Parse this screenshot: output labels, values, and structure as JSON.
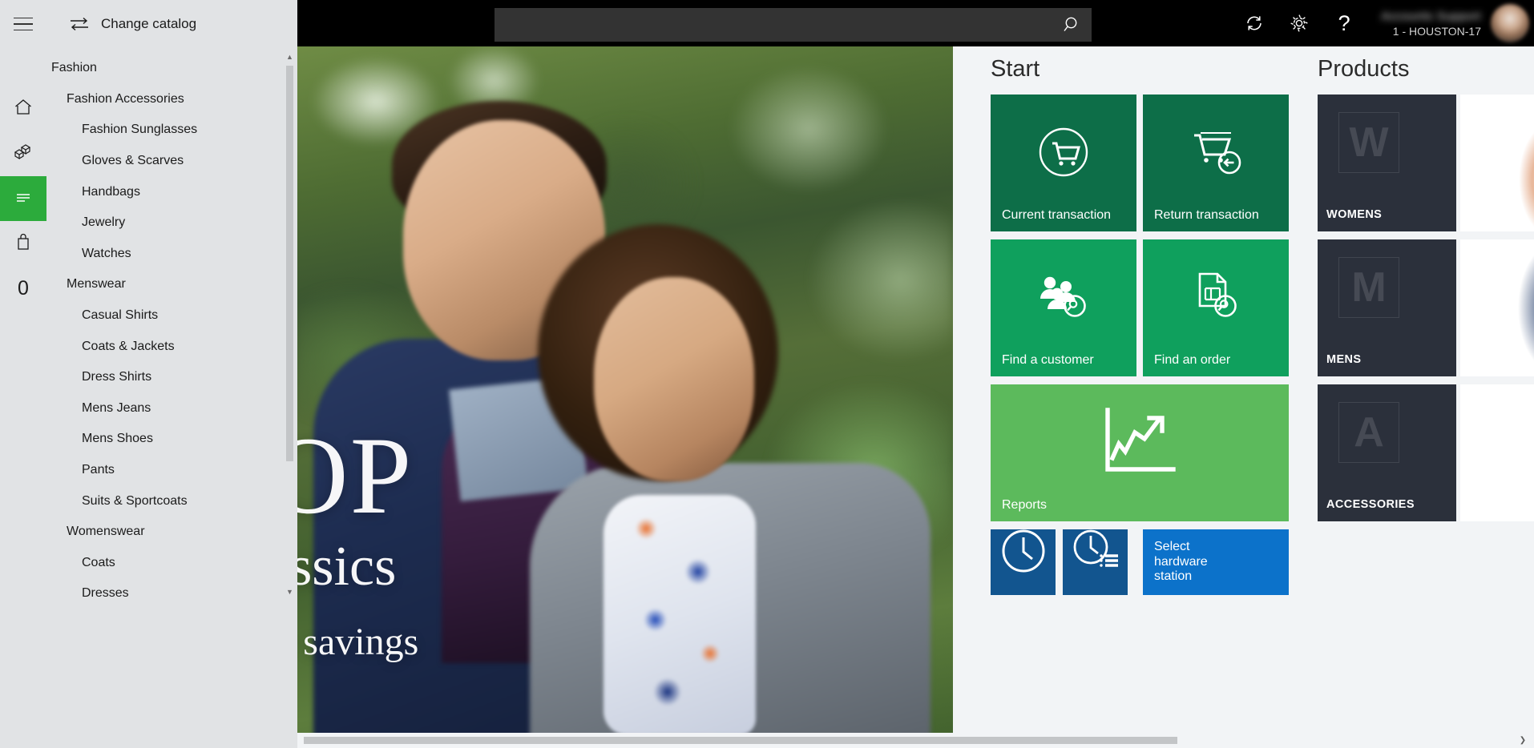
{
  "sidebar": {
    "hamburger_label": "menu-toggle",
    "change_catalog_label": "Change catalog",
    "rail": [
      {
        "name": "home",
        "glyph": "home-icon"
      },
      {
        "name": "products",
        "glyph": "products-icon"
      },
      {
        "name": "categories",
        "glyph": "categories-icon",
        "active": true
      },
      {
        "name": "bag",
        "glyph": "shopping-bag-icon"
      },
      {
        "name": "count",
        "glyph": "0"
      }
    ],
    "categories": [
      {
        "label": "Fashion",
        "level": 0
      },
      {
        "label": "Fashion Accessories",
        "level": 1
      },
      {
        "label": "Fashion Sunglasses",
        "level": 2
      },
      {
        "label": "Gloves & Scarves",
        "level": 2
      },
      {
        "label": "Handbags",
        "level": 2
      },
      {
        "label": "Jewelry",
        "level": 2
      },
      {
        "label": "Watches",
        "level": 2
      },
      {
        "label": "Menswear",
        "level": 1
      },
      {
        "label": "Casual Shirts",
        "level": 2
      },
      {
        "label": "Coats & Jackets",
        "level": 2
      },
      {
        "label": "Dress Shirts",
        "level": 2
      },
      {
        "label": "Mens Jeans",
        "level": 2
      },
      {
        "label": "Mens Shoes",
        "level": 2
      },
      {
        "label": "Pants",
        "level": 2
      },
      {
        "label": "Suits & Sportcoats",
        "level": 2
      },
      {
        "label": "Womenswear",
        "level": 1
      },
      {
        "label": "Coats",
        "level": 2
      },
      {
        "label": "Dresses",
        "level": 2
      }
    ],
    "scroll_up_glyph": "▲",
    "scroll_down_glyph": "▼"
  },
  "topbar": {
    "search": {
      "value": "",
      "placeholder": ""
    },
    "search_icon": "search-icon",
    "refresh_icon": "refresh-icon",
    "settings_icon": "gear-icon",
    "help_label": "?",
    "user_name": "Accounts Support",
    "user_station": "1 - HOUSTON-17"
  },
  "hero": {
    "line1": "OP",
    "line2": "assics",
    "line3": "e savings"
  },
  "start": {
    "title": "Start",
    "tiles": [
      {
        "label": "Current transaction",
        "icon": "cart-circle-icon",
        "color": "t-dark"
      },
      {
        "label": "Return transaction",
        "icon": "cart-return-icon",
        "color": "t-dark"
      },
      {
        "label": "Find a customer",
        "icon": "customer-search-icon",
        "color": "t-mid"
      },
      {
        "label": "Find an order",
        "icon": "order-search-icon",
        "color": "t-mid"
      },
      {
        "label": "Reports",
        "icon": "chart-growth-icon",
        "color": "t-light"
      },
      {
        "label": "",
        "icon": "clock-icon",
        "color": "t-navy"
      },
      {
        "label": "",
        "icon": "clock-list-icon",
        "color": "t-navy"
      },
      {
        "label": "Select hardware station",
        "icon": "",
        "color": "t-blue"
      }
    ]
  },
  "products": {
    "title": "Products",
    "items": [
      {
        "letter": "W",
        "label": "WOMENS"
      },
      {
        "letter": "M",
        "label": "MENS"
      },
      {
        "letter": "A",
        "label": "ACCESSORIES"
      }
    ]
  },
  "hscroll": {
    "right_arrow_glyph": "❯"
  },
  "colors": {
    "tile_dark_green": "#0d6e48",
    "tile_mid_green": "#0fa05d",
    "tile_light_green": "#5cba5c",
    "tile_navy": "#12558f",
    "tile_blue": "#0c72ca",
    "rail_active": "#2cab3c",
    "sidebar_bg": "#e1e3e5",
    "topbar_bg": "#000000",
    "product_card_bg": "#2b303b"
  }
}
